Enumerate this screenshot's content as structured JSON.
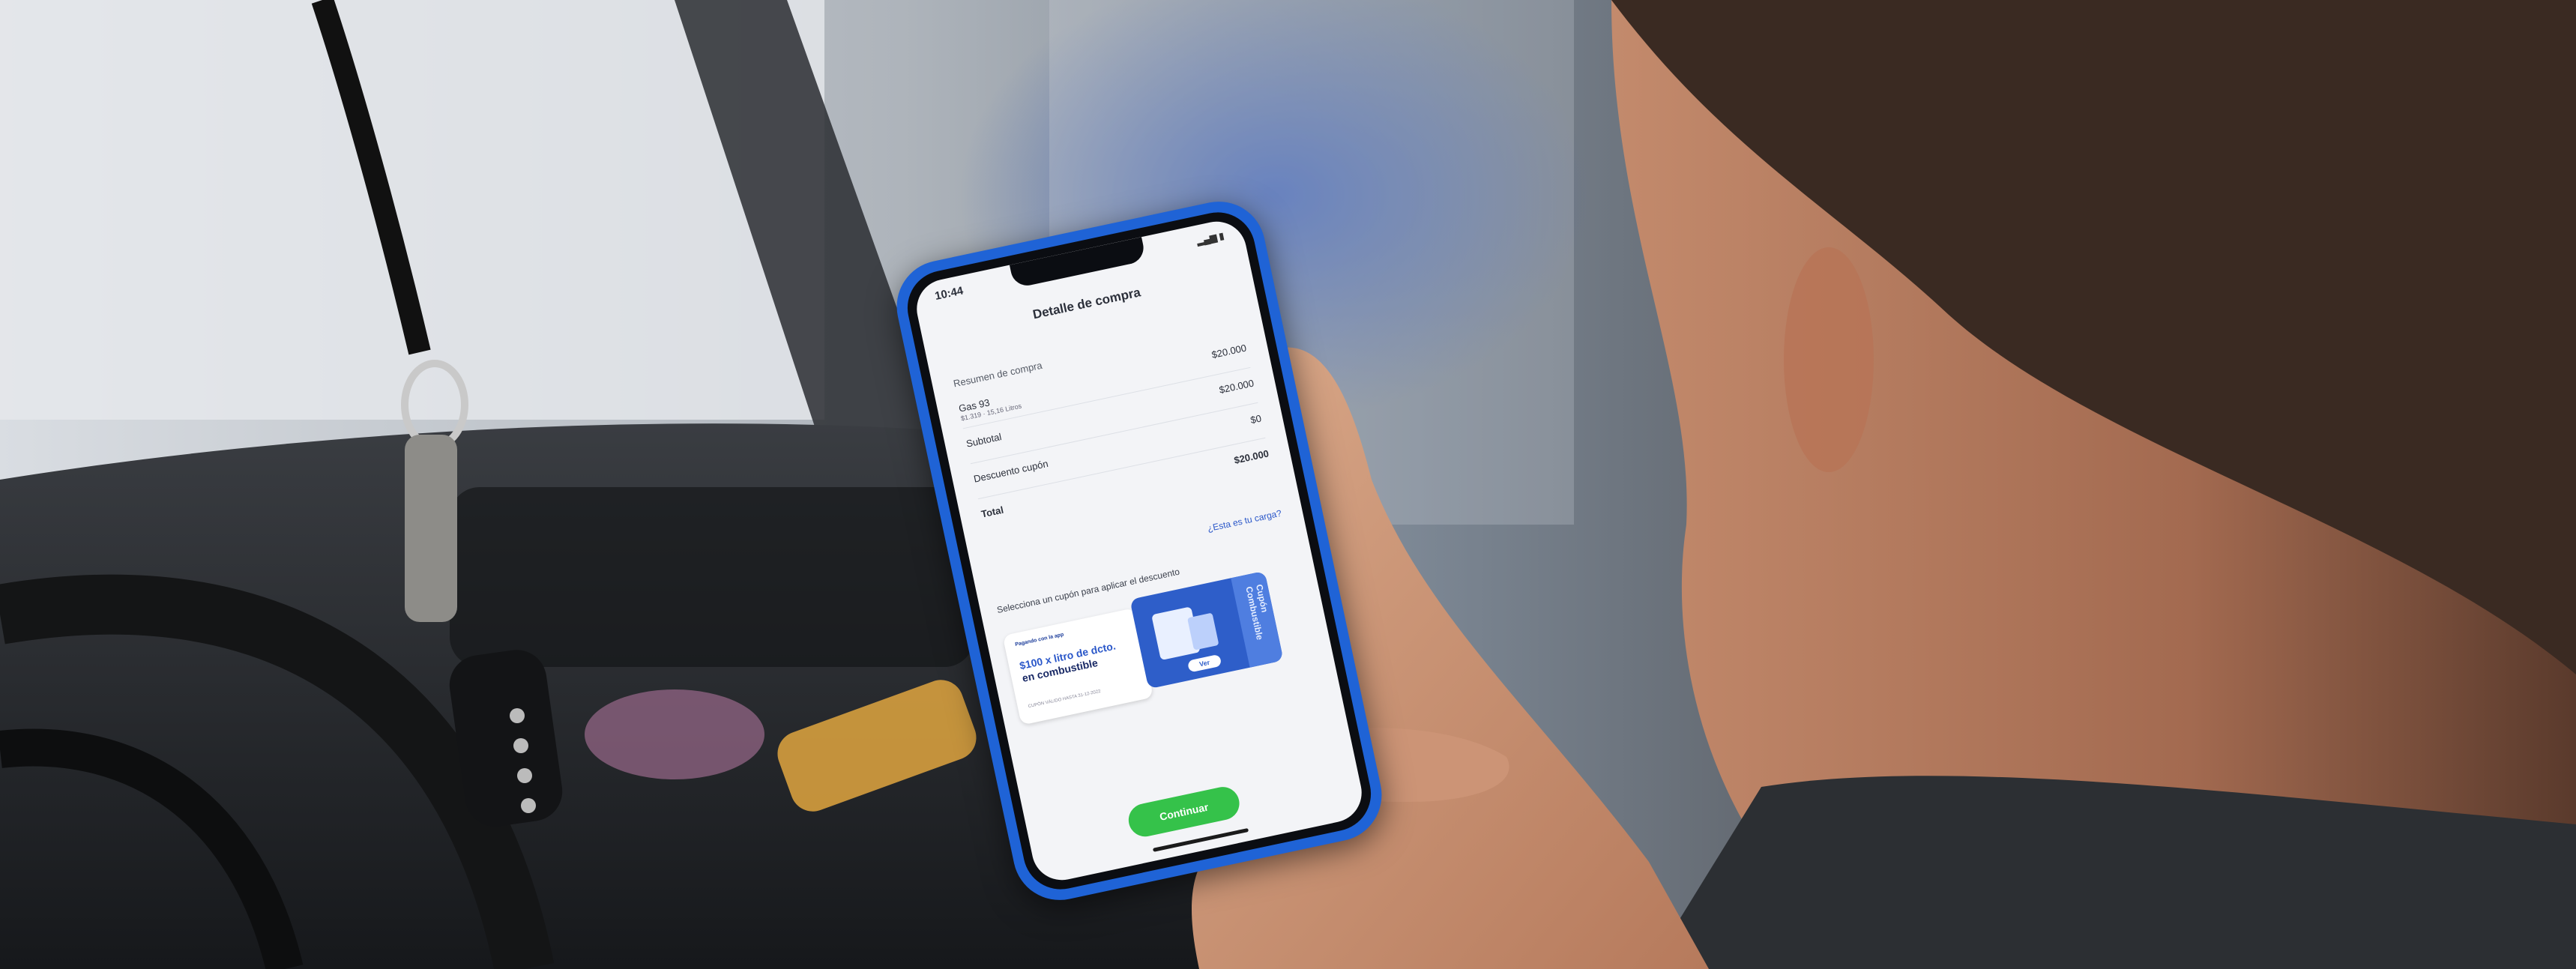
{
  "phone_screen": {
    "status_time": "10:44",
    "title": "Detalle de compra",
    "summary_label": "Resumen de compra",
    "rows": [
      {
        "label": "Gas 93",
        "sub": "$1.319 · 15,16 Litros",
        "value": "$20.000"
      },
      {
        "label": "Subtotal",
        "value": "$20.000"
      },
      {
        "label": "Descuento cupón",
        "value": "$0"
      },
      {
        "label": "Total",
        "value": "$20.000"
      }
    ],
    "link": "¿Esta es tu carga?",
    "instruction": "Selecciona un cupón para aplicar el descuento",
    "coupon": {
      "brand": "Pagando con la app",
      "title_line1": "$100 x litro de dcto.",
      "title_line2": "en combustible",
      "validity": "CUPÓN VÁLIDO HASTA 31-12-2022",
      "tab": "Cupón Combustible",
      "action": "Ver"
    },
    "continue_label": "Continuar"
  },
  "colors": {
    "phone_case": "#1f63d6",
    "continue_button": "#35c24a",
    "coupon_blue": "#2e5ec9"
  }
}
